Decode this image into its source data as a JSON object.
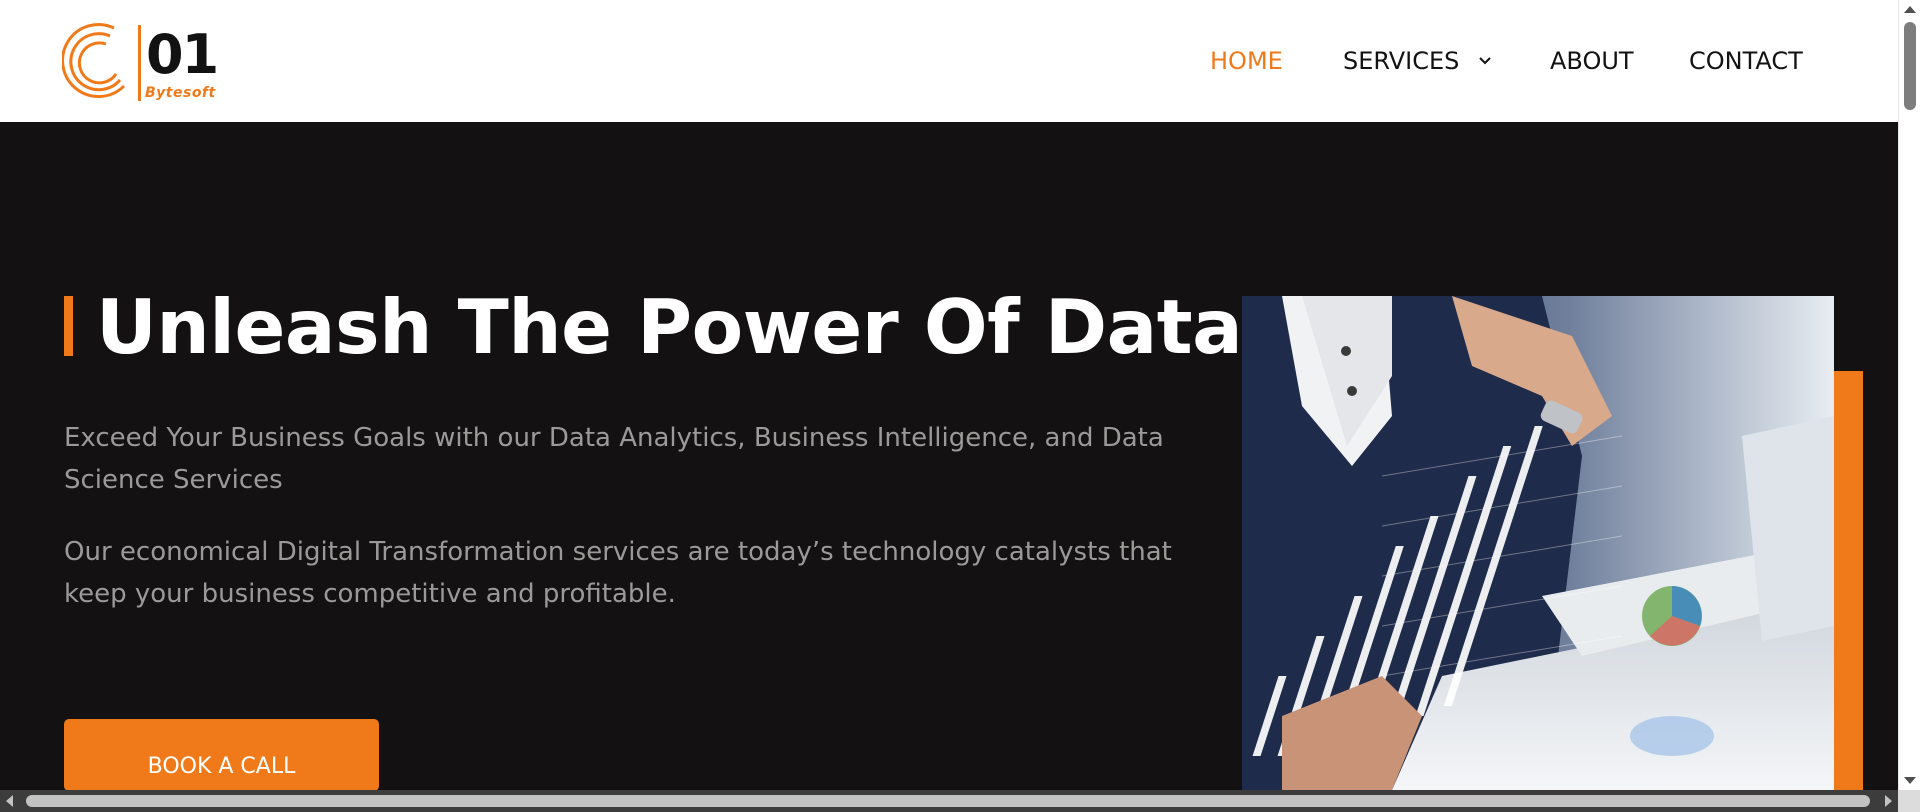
{
  "brand": {
    "number": "01",
    "name": "Bytesoft",
    "accent_color": "#f07a1a"
  },
  "nav": {
    "home": "HOME",
    "services": "SERVICES",
    "about": "ABOUT",
    "contact": "CONTACT",
    "active": "HOME"
  },
  "hero": {
    "title": "Unleash The Power Of Data",
    "subtitle": "Exceed Your Business Goals with our Data Analytics, Business Intelligence, and Data Science Services",
    "description": "Our economical Digital Transformation services are today’s technology catalysts that keep your business competitive and profitable.",
    "cta_label": "BOOK A CALL"
  },
  "colors": {
    "background": "#131112",
    "header": "#ffffff",
    "accent": "#f07a1a",
    "muted_text": "#9b9a99"
  },
  "icons": {
    "dropdown": "chevron-down-icon",
    "logo": "logo-icon"
  }
}
